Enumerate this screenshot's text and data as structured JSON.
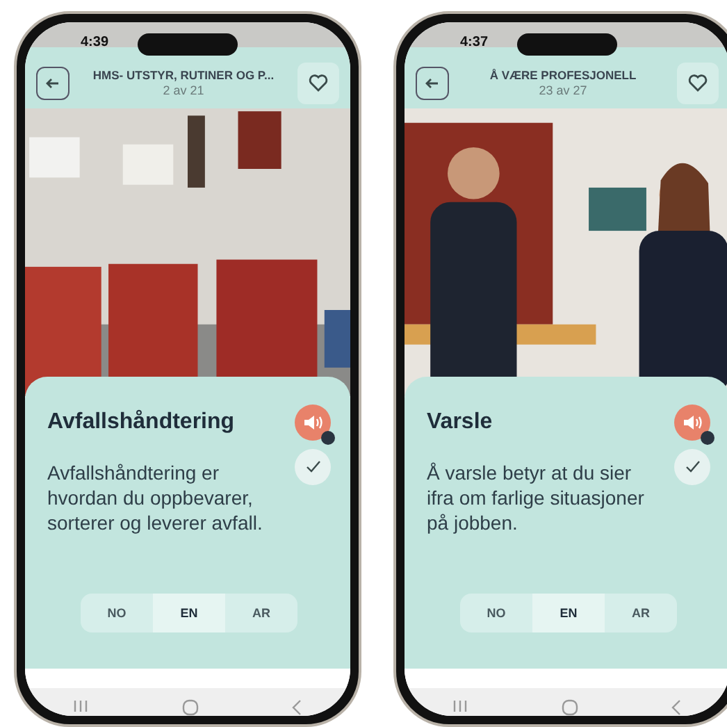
{
  "phones": [
    {
      "status_time": "4:39",
      "title": "HMS- UTSTYR, RUTINER OG P...",
      "counter": "2 av 21",
      "card": {
        "heading": "Avfallshåndtering",
        "body": "Avfallshåndtering er hvordan du oppbevarer, sorterer og leverer avfall.",
        "done": false,
        "languages": [
          {
            "label": "NO",
            "selected": false
          },
          {
            "label": "EN",
            "selected": true
          },
          {
            "label": "AR",
            "selected": false
          }
        ]
      }
    },
    {
      "status_time": "4:37",
      "title": "Å VÆRE PROFESJONELL",
      "counter": "23 av 27",
      "card": {
        "heading": "Varsle",
        "body": "Å varsle betyr at du sier ifra om farlige situasjoner på jobben.",
        "done": false,
        "languages": [
          {
            "label": "NO",
            "selected": false
          },
          {
            "label": "EN",
            "selected": true
          },
          {
            "label": "AR",
            "selected": false
          }
        ]
      }
    }
  ]
}
